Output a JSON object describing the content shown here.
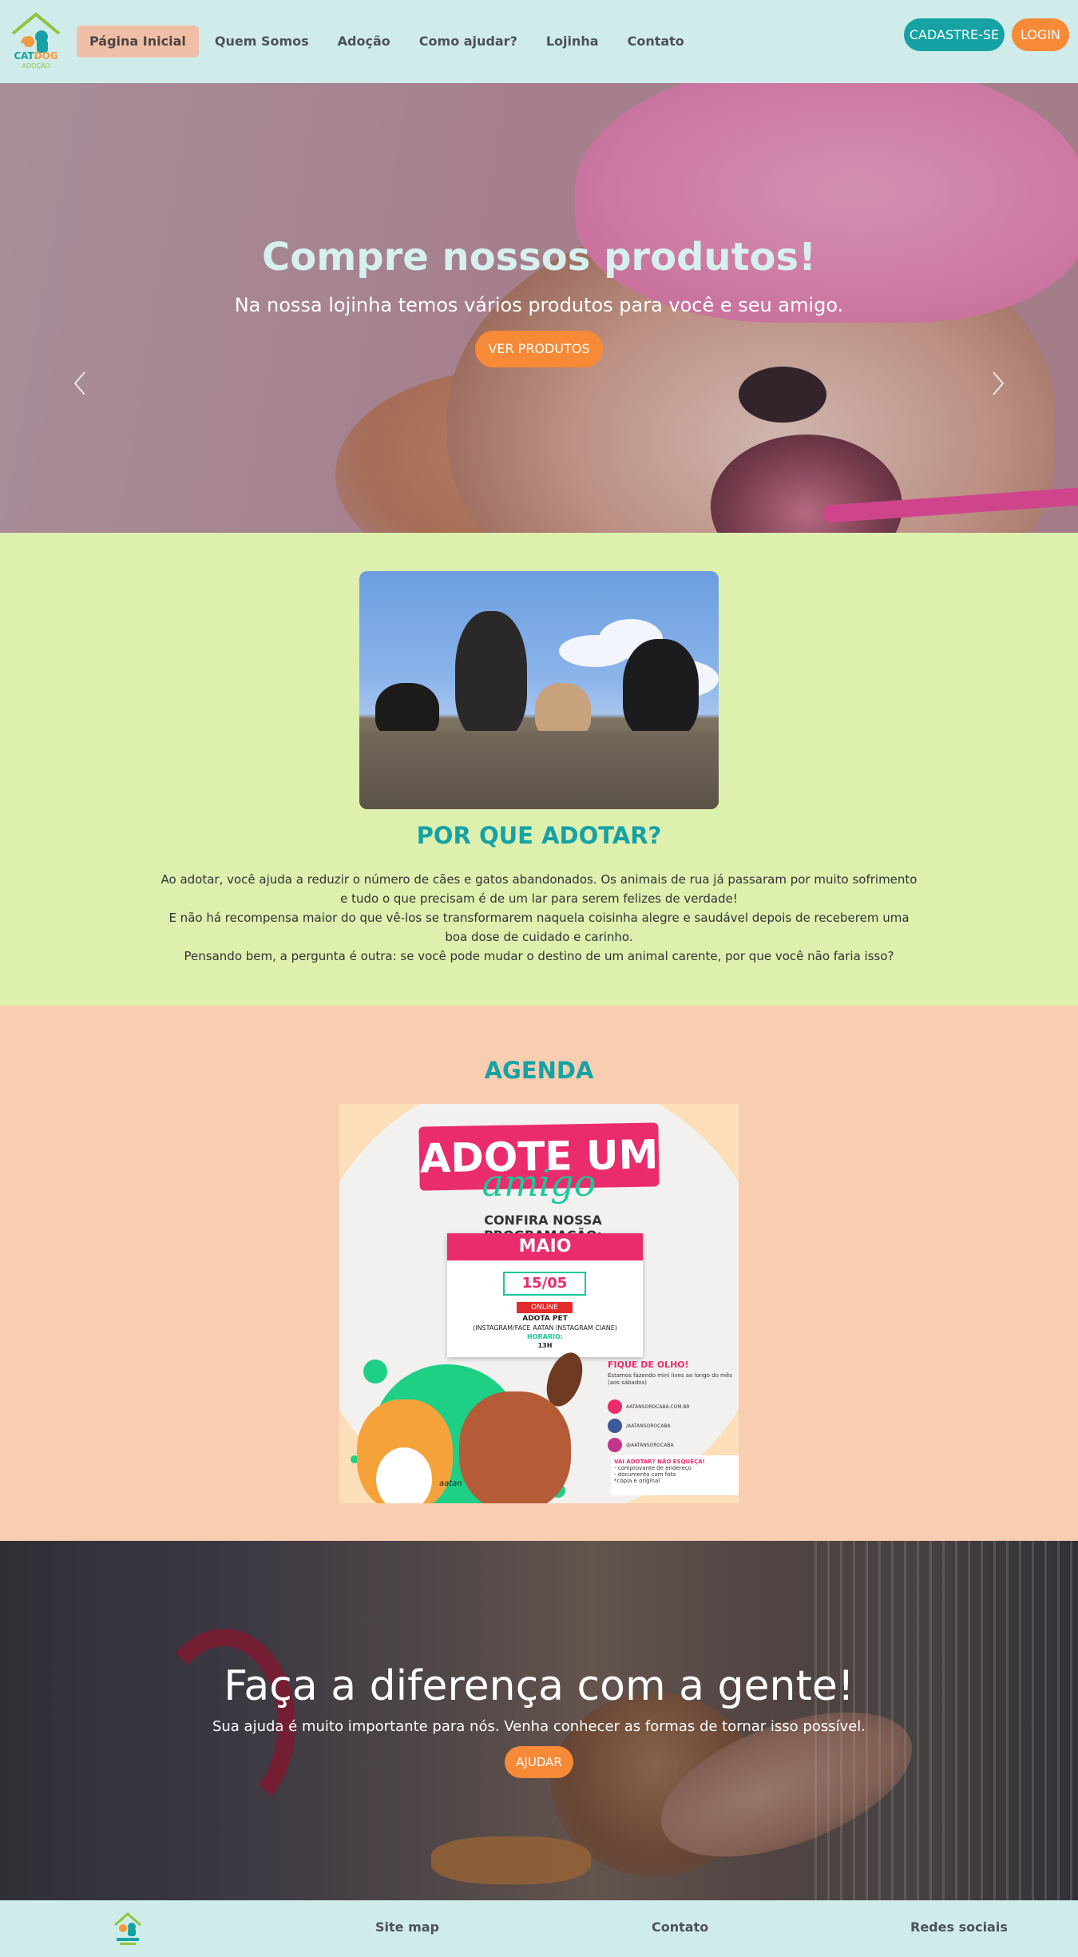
{
  "navbar": {
    "logo": {
      "line1": "CAT",
      "line2": "DOG",
      "line3": "ADOÇÃO"
    },
    "links": [
      {
        "label": "Página Inicial",
        "active": true
      },
      {
        "label": "Quem Somos"
      },
      {
        "label": "Adoção"
      },
      {
        "label": "Como ajudar?"
      },
      {
        "label": "Lojinha"
      },
      {
        "label": "Contato"
      }
    ],
    "signup_label": "CADASTRE-SE",
    "login_label": "LOGIN"
  },
  "hero": {
    "title": "Compre nossos produtos!",
    "subtitle": "Na nossa lojinha temos vários produtos para você e seu amigo.",
    "button_label": "VER PRODUTOS",
    "prev_icon": "chevron-left-icon",
    "next_icon": "chevron-right-icon"
  },
  "adopt": {
    "title": "POR QUE ADOTAR?",
    "paragraph1": "Ao adotar, você ajuda a reduzir o número de cães e gatos abandonados. Os animais de rua já passaram por muito sofrimento e tudo o que precisam é de um lar para serem felizes de verdade!",
    "paragraph2": "E não há recompensa maior do que vê-los se transformarem naquela coisinha alegre e saudável depois de receberem uma boa dose de cuidado e carinho.",
    "paragraph3": "Pensando bem, a pergunta é outra: se você pode mudar o destino de um animal carente, por que você não faria isso?"
  },
  "agenda": {
    "title": "AGENDA",
    "poster": {
      "headline": "ADOTE UM",
      "script": "amigo",
      "confira": "CONFIRA NOSSA PROGRAMAÇÃO:",
      "month": "MAIO",
      "date": "15/05",
      "online": "ONLINE",
      "event": "ADOTA PET",
      "channels": "(INSTAGRAM/FACE AATAN INSTAGRAM CIANE)",
      "horario_label": "HORÁRIO:",
      "horario": "13H",
      "fique": "FIQUE DE OLHO!",
      "fique_text": "Estamos fazendo mini lives ao longo do mês (aos sábados)",
      "site": "AATANSOROCABA.COM.BR",
      "facebook": "/AATANSOROCABA",
      "instagram": "@AATANSOROCABA",
      "vai": "VAI ADOTAR? NÃO ESQUEÇA!",
      "req1": "- comprovante de endereço",
      "req2": "- documento com foto",
      "req3": "*cópia e original",
      "brand": "aatan"
    }
  },
  "help": {
    "title": "Faça a diferença com a gente!",
    "subtitle": "Sua ajuda é muito importante para nós. Venha conhecer as formas de tornar isso possível.",
    "button_label": "AJUDAR"
  },
  "footer": {
    "links": [
      "Site map",
      "Contato",
      "Redes sociais"
    ]
  },
  "colors": {
    "navbar_bg": "#d0ecea",
    "accent_teal": "#16a2a5",
    "accent_orange": "#f78a37",
    "adopt_bg": "#ddf0ae",
    "agenda_bg": "#f9cdb0"
  }
}
